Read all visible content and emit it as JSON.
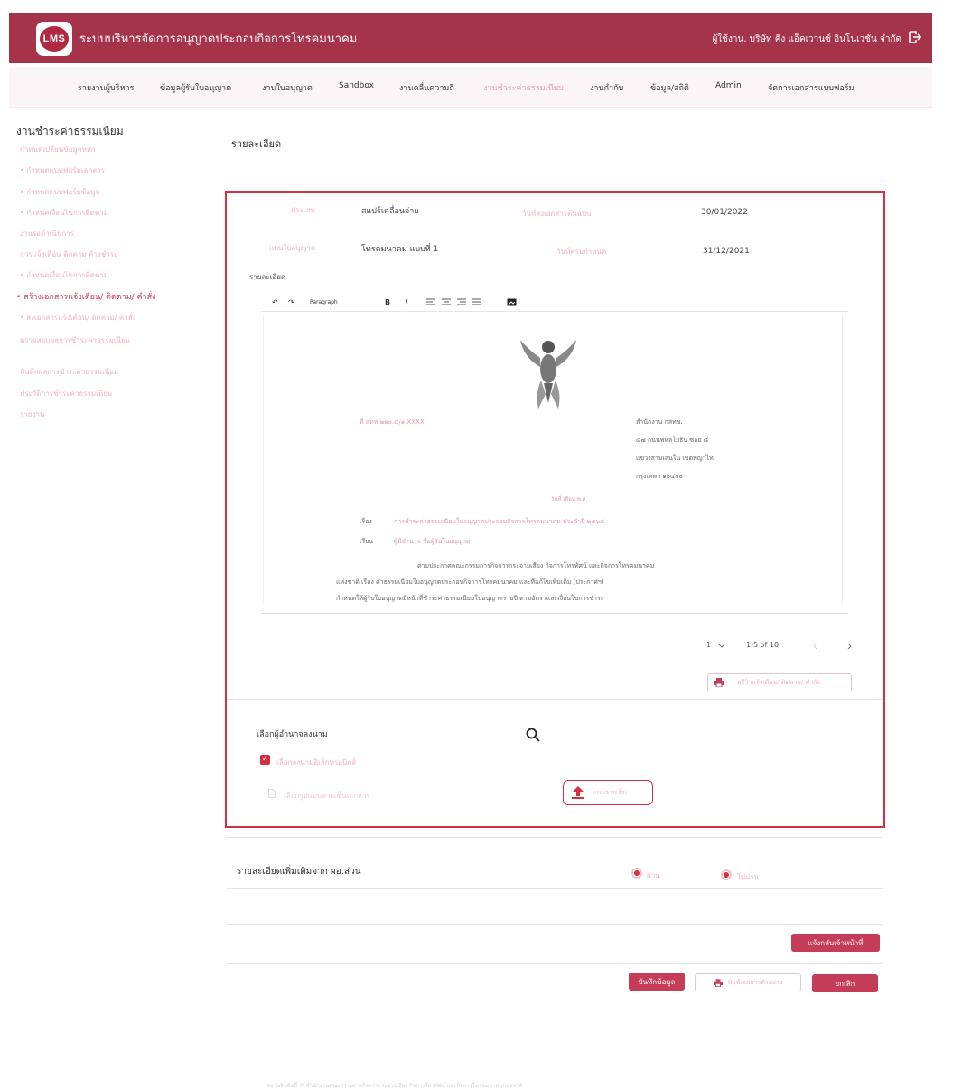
{
  "header": {
    "logo_text": "LMS",
    "title": "ระบบบริหารจัดการอนุญาตประกอบกิจการโทรคมนาคม",
    "user": "ผู้ใช้งาน, บริษัท คิง แอ็คเวานซ์ อินโนเวชั่น จำกัด"
  },
  "nav": [
    "รายงานผู้บริหาร",
    "ข้อมูลผู้รับใบอนุญาต",
    "งานใบอนุญาต",
    "Sandbox",
    "งานคลื่นความถี่",
    "งานชำระค่าธรรมเนียม",
    "งานกำกับ",
    "ข้อมูล/สถิติ",
    "Admin",
    "จัดการเอกสารแบบฟอร์ม"
  ],
  "sidebar": {
    "title": "งานชำระค่าธรรมเนียม",
    "items": [
      "กำหนดเปลี่ยนข้อมูลหลัก",
      "• กำหนดแบบฟอร์มเอกสาร",
      "• กำหนดแบบฟอร์มข้อมูล",
      "• กำหนดเงื่อนไขการติดตาม",
      "งานรอดำเนินการ",
      "การแจ้งเตือน ติดตาม ค้างชำระ",
      "• กำหนดเงื่อนไขการติดตาม",
      "• สร้างเอกสารแจ้งเตือน/ ติดตาม/ คำสั่ง",
      "• ส่งเอกสารแจ้งเตือน/ ติดตาม/ คำสั่ง",
      "ตรวจสอบผลการชำระค่าธรรมเนียม",
      "บันทึกผลการชำระค่าธรรมเนียม",
      "ประวัติการชำระค่าธรรมเนียม",
      "รายงาน"
    ]
  },
  "section_title": "รายละเอียด",
  "details": {
    "type_label": "ประเภท",
    "type_value": "สแปร์เคลื่อนจ่าย",
    "date1_label": "วันที่ส่งเอกสารต้นฉบับ",
    "date1_value": "30/01/2022",
    "license_label": "แบบใบอนุญาต",
    "license_value": "โทรคมนาคม แบบที่ 1",
    "date2_label": "วันที่ครบกำหนด",
    "date2_value": "31/12/2021",
    "detail_label": "รายละเอียด"
  },
  "editor": {
    "undo": "↶",
    "redo": "↷",
    "paragraph": "Paragraph",
    "bold": "B",
    "italic": "I",
    "doc": {
      "ref_no": "ที่ สทท ๒๑๐.๔/๑ XXXX",
      "office_lines": [
        "สำนักงาน กสทช.",
        "๘๗ ถนนพหลโยธิน ซอย ๘",
        "แขวงสามเสนใน เขตพญาไท",
        "กรุงเทพฯ ๑๐๔๐๐"
      ],
      "date": "วันที่ เดือน พ.ศ.",
      "subject_label": "เรื่อง",
      "subject": "การชำระค่าธรรมเนียมใบอนุญาตประกอบกิจการโทรคมนาคม ประจำปี ๒๕๖๔",
      "to_label": "เรียน",
      "to": "ผู้มีอำนาจ ชื่อผู้รับใบอนุญาต",
      "body": [
        "ตามประกาศคณะกรรมการกิจการกระจายเสียง กิจการโทรทัศน์ และกิจการโทรคมนาคม",
        "แห่งชาติ เรื่อง ค่าธรรมเนียมใบอนุญาตประกอบกิจการโทรคมนาคม และที่แก้ไขเพิ่มเติม (ประกาศฯ)",
        "กำหนดให้ผู้รับใบอนุญาตมีหน้าที่ชำระค่าธรรมเนียมใบอนุญาตรายปี ตามอัตราและเงื่อนไขการชำระ"
      ]
    }
  },
  "pager": {
    "page": "1",
    "range": "1-5 of 10"
  },
  "preview_button": "พรีวิวแจ้งเตือน/ ติดตาม/ คำสั่ง",
  "signer": {
    "label": "เลือกผู้อำนาจลงนาม",
    "checkbox_label": "เลือกลงนามอิเล็กทรอนิกส์",
    "file_label": "เลือกรูปแบบลายเซ็นเอกสาร",
    "upload_button": "แนบลายเซ็น"
  },
  "extra": {
    "title": "รายละเอียดเพิ่มเติมจาก ผอ.ส่วน",
    "option_yes": "ผ่าน",
    "option_no": "ไม่ผ่าน"
  },
  "buttons": {
    "send": "แจ้งกลับเจ้าหน้าที่",
    "save": "บันทึกข้อมูล",
    "print": "พิมพ์เอกสารตัวอย่าง",
    "cancel": "ยกเลิก"
  },
  "footer": "สงวนลิขสิทธิ์ © สำนักงานคณะกรรมการกิจการกระจายเสียง กิจการโทรทัศน์ และกิจการโทรคมนาคมแห่งชาติ"
}
